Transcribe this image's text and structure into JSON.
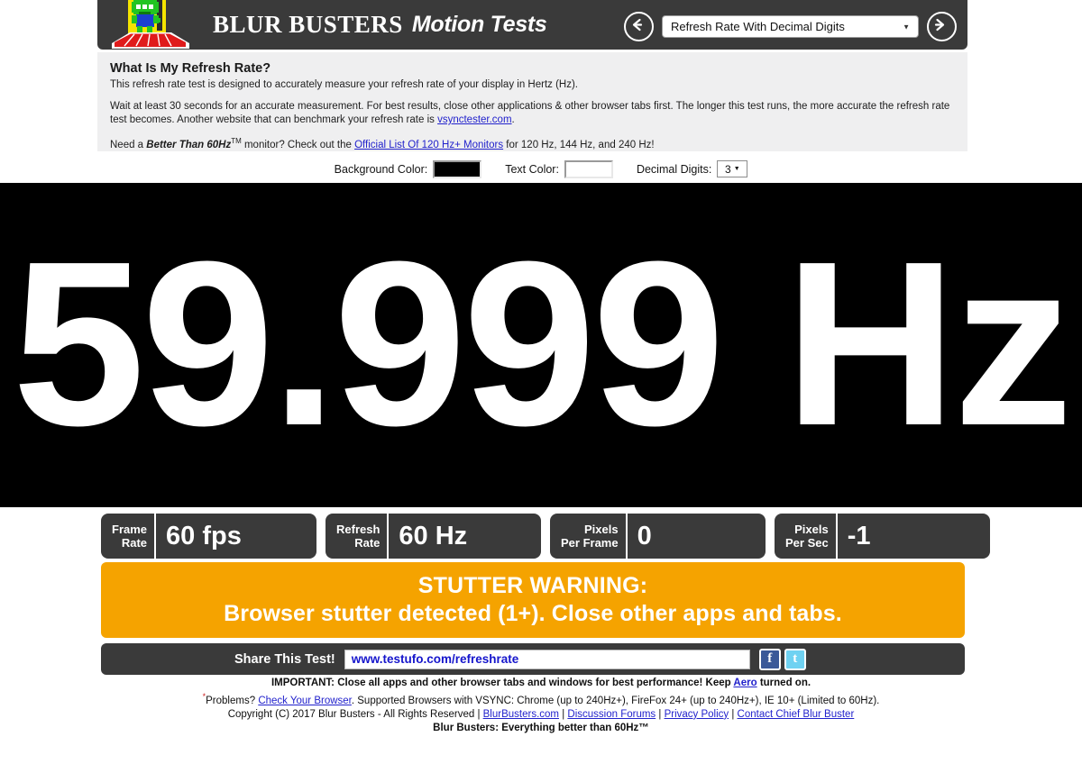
{
  "header": {
    "logo_icon": "blur-busters-alien-logo",
    "brand_primary": "BLUR  BUSTERS",
    "brand_secondary": "Motion Tests",
    "prev_icon": "arrow-left-icon",
    "next_icon": "arrow-right-icon",
    "test_selector": {
      "value": "Refresh Rate With Decimal Digits",
      "caret_icon": "chevron-down-icon"
    }
  },
  "info": {
    "title": "What Is My Refresh Rate?",
    "paragraph1": "This refresh rate test is designed to accurately measure your refresh rate of your display in Hertz (Hz).",
    "paragraph2_a": "Wait at least 30 seconds for an accurate measurement. For best results, close other applications & other browser tabs first. The longer this test runs, the more accurate the refresh rate test becomes. Another website that can benchmark your refresh rate is ",
    "paragraph2_link": "vsynctester.com",
    "paragraph2_b": ".",
    "paragraph3_a": "Need a ",
    "paragraph3_em": "Better Than 60Hz",
    "paragraph3_tm": "TM",
    "paragraph3_b": " monitor? Check out the ",
    "paragraph3_link": "Official List Of 120 Hz+ Monitors",
    "paragraph3_c": " for 120 Hz, 144 Hz, and 240 Hz!"
  },
  "options": {
    "background_color_label": "Background Color:",
    "background_color_value": "#000000",
    "text_color_label": "Text Color:",
    "text_color_value": "#ffffff",
    "decimal_digits_label": "Decimal Digits:",
    "decimal_digits_value": "3",
    "caret_icon": "chevron-down-icon"
  },
  "display": {
    "value": "59.999 Hz",
    "background": "#000000",
    "foreground": "#ffffff"
  },
  "stats": [
    {
      "label_line1": "Frame",
      "label_line2": "Rate",
      "value": "60 fps"
    },
    {
      "label_line1": "Refresh",
      "label_line2": "Rate",
      "value": "60 Hz"
    },
    {
      "label_line1": "Pixels",
      "label_line2": "Per Frame",
      "value": "0"
    },
    {
      "label_line1": "Pixels",
      "label_line2": "Per Sec",
      "value": "-1"
    }
  ],
  "warning": {
    "line1": "STUTTER WARNING:",
    "line2": "Browser stutter detected (1+). Close other apps and tabs.",
    "color": "#f5a300"
  },
  "share": {
    "label": "Share This Test!",
    "url": "www.testufo.com/refreshrate",
    "facebook_icon": "facebook-icon",
    "facebook_glyph": "f",
    "twitter_icon": "twitter-icon",
    "twitter_glyph": "t"
  },
  "footer": {
    "line1_a": "IMPORTANT: Close all apps and other browser tabs and windows for best performance! Keep ",
    "line1_link": "Aero",
    "line1_b": " turned on.",
    "line2_star": "*",
    "line2_a": "Problems? ",
    "line2_link": "Check Your Browser",
    "line2_b": ". Supported Browsers with VSYNC: Chrome (up to 240Hz+), FireFox 24+ (up to 240Hz+), IE 10+ (Limited to 60Hz).",
    "line3_a": "Copyright (C) 2017 Blur Busters - All Rights Reserved | ",
    "line3_link1": "BlurBusters.com",
    "line3_sep1": " | ",
    "line3_link2": "Discussion Forums",
    "line3_sep2": " | ",
    "line3_link3": "Privacy Policy",
    "line3_sep3": " | ",
    "line3_link4": "Contact Chief Blur Buster",
    "line4": "Blur Busters: Everything better than 60Hz™"
  }
}
